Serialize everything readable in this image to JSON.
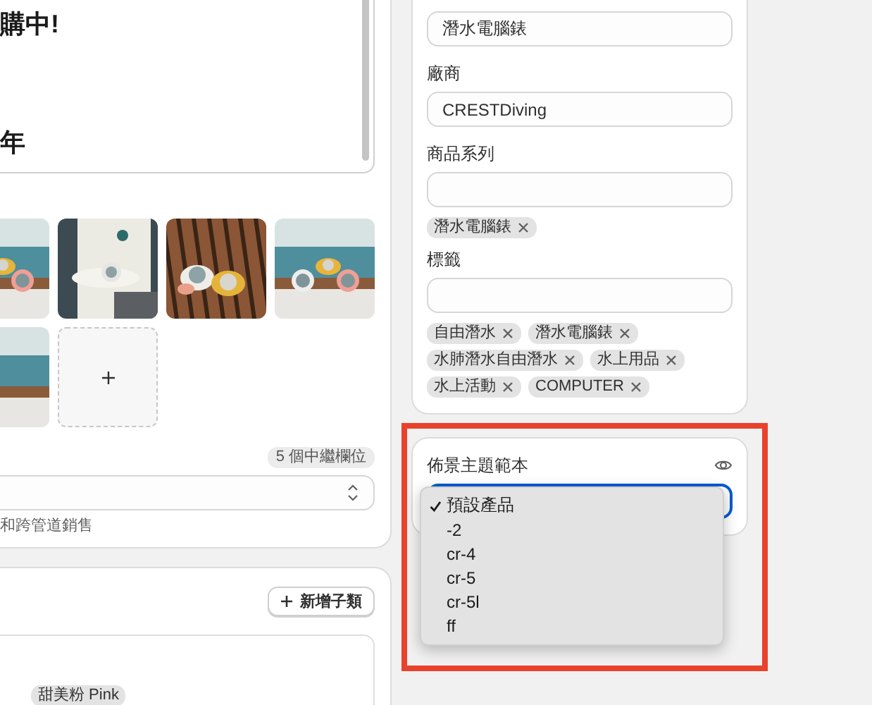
{
  "description_editor": {
    "lines": [
      "購中!",
      "年"
    ]
  },
  "metafields": {
    "badge": "5 個中繼欄位",
    "helper_text": "和跨管道銷售"
  },
  "variants": {
    "add_button": "新增子類",
    "tags": [
      "甜美粉 Pink"
    ]
  },
  "organization": {
    "fields": [
      {
        "value": "潛水電腦錶"
      },
      {
        "label": "廠商",
        "value": "CRESTDiving"
      },
      {
        "label": "商品系列",
        "tags": [
          "潛水電腦錶"
        ]
      },
      {
        "label": "標籤",
        "tags": [
          "自由潛水",
          "潛水電腦錶",
          "水肺潛水自由潛水",
          "水上用品",
          "水上活動",
          "COMPUTER"
        ]
      }
    ]
  },
  "theme_template": {
    "label": "佈景主題範本",
    "options": [
      {
        "label": "預設產品",
        "selected": true
      },
      {
        "label": "-2",
        "selected": false
      },
      {
        "label": "cr-4",
        "selected": false
      },
      {
        "label": "cr-5",
        "selected": false
      },
      {
        "label": "cr-5l",
        "selected": false
      },
      {
        "label": "ff",
        "selected": false
      }
    ]
  }
}
